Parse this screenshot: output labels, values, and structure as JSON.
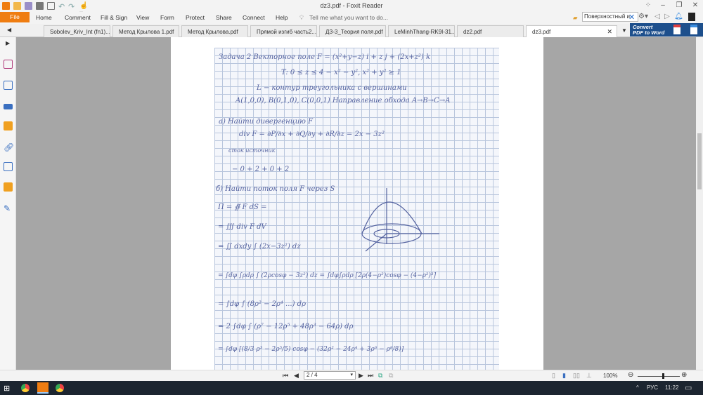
{
  "window": {
    "title": "dz3.pdf - Foxit Reader"
  },
  "ribbon": {
    "file": "File",
    "tabs": [
      "Home",
      "Comment",
      "Fill & Sign",
      "View",
      "Form",
      "Protect",
      "Share",
      "Connect",
      "Help"
    ],
    "tell_me": "Tell me what you want to do...",
    "search_value": "Поверхностный и"
  },
  "doc_tabs": [
    "Sobolev_Kriv_Int (fn1)...",
    "Метод Крылова 1.pdf",
    "Метод Крылова.pdf",
    "Прямой изгиб часть2....",
    "ДЗ-3_Теория поля.pdf",
    "LeMinhThang-RK9I-31...",
    "dz2.pdf",
    "dz3.pdf"
  ],
  "convert": {
    "line1": "Convert",
    "line2": "PDF to Word"
  },
  "document": {
    "lines": [
      "Задача 2  Векторное поле F = (x²+y−z) i + z j + (2x+z²) k",
      "T:  0 ≤ z ≤ 4 − x² − y²,  x² + y² ≥ 1",
      "L − контур треугольника с вершинами",
      "A(1,0,0), B(0,1,0), C(0,0,1)   Направление обхода A→B→C→A",
      "а) Найти дивергенцию F",
      "div F = ∂P/∂x + ∂Q/∂y + ∂R/∂z = 2x − 3z²",
      "сток         источник",
      "− 0 + 2          + 0 + 2",
      "б) Найти поток поля F через S",
      "Π = ∯ F dS =",
      "= ∭ div F dV",
      "= ∬ dxdy ∫ (2x−3z²) dz",
      "= ∫dφ ∫ρdρ ∫ (2ρcosφ − 3z²) dz = ∫dφ∫ρdρ [2ρ(4−ρ²)cosφ − (4−ρ²)³]",
      "= ∫dφ ∫ (8ρ² − 2ρ⁴ ...) dρ",
      "= 2 ∫dφ ∫ (ρ⁷ − 12ρ⁵ + 48ρ³ − 64ρ) dρ",
      "= ∫dφ [(8/3 ρ³ − 2ρ⁵/5) cosφ − (32ρ² − 24ρ⁴ + 3ρ⁶ − ρ⁸/8)]"
    ]
  },
  "status": {
    "page": "2 / 4",
    "zoom": "100%"
  },
  "taskbar": {
    "lang": "РУС",
    "time": "11:22"
  }
}
